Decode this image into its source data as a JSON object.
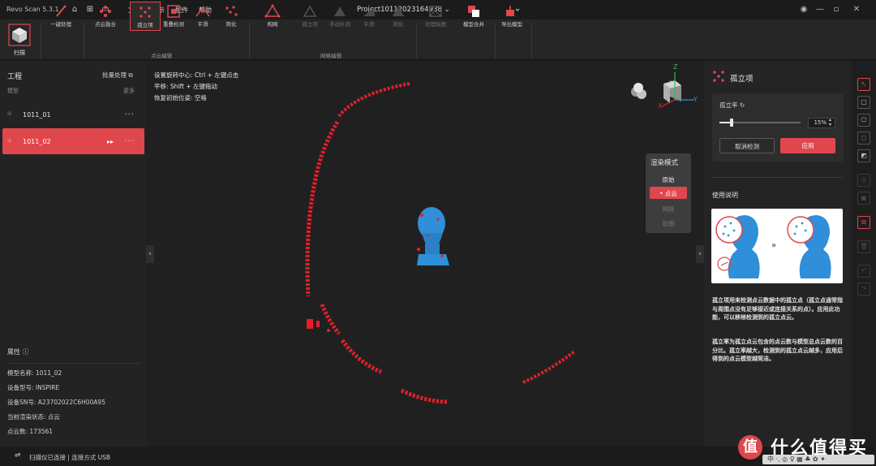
{
  "titlebar": {
    "app_name": "Revo Scan 5.3.1",
    "menus": [
      "文件",
      "显示",
      "配件",
      "帮助"
    ],
    "project": "Project10112023164938"
  },
  "toolbar": {
    "scan": "扫描",
    "one_click": "一键处理",
    "fusion": "点云融合",
    "isolate": "孤立项",
    "overlap": "重叠检测",
    "smooth": "平滑",
    "simplify": "简化",
    "mesh": "构网",
    "mesh_isolate": "孤立项",
    "fill_holes": "手动补洞",
    "mesh_smooth": "平滑",
    "mesh_simplify": "简化",
    "texture": "纹理贴图",
    "merge": "模型合并",
    "export": "导出模型",
    "group_pointcloud": "点云编辑",
    "group_mesh": "网格编辑"
  },
  "left_panel": {
    "title": "工程",
    "batch": "批量处理",
    "sub": "模型",
    "more": "更多",
    "models": [
      "1011_01",
      "1011_02"
    ],
    "attr_title": "属性",
    "attrs": [
      {
        "label": "模型名称:",
        "value": "1011_02"
      },
      {
        "label": "设备型号:",
        "value": "INSPIRE"
      },
      {
        "label": "设备SN号:",
        "value": "A23702022C6H00A95"
      },
      {
        "label": "当前渲染状态:",
        "value": "点云"
      },
      {
        "label": "点云数:",
        "value": "173561"
      }
    ]
  },
  "viewport": {
    "hints": [
      "设置旋转中心: Ctrl + 左键点击",
      "平移: Shift + 左键拖动",
      "恢复初始位姿: 空格"
    ],
    "render_mode": {
      "title": "渲染模式",
      "options": [
        "原始",
        "点云",
        "网格",
        "贴图"
      ],
      "selected": "点云"
    },
    "axes": {
      "x": "X",
      "y": "Y",
      "z": "Z"
    }
  },
  "right_panel": {
    "title": "孤立项",
    "rate_label": "孤立率",
    "rate_value": "15%",
    "rate_fraction": 0.15,
    "cancel": "取消检测",
    "apply": "应用",
    "usage_title": "使用说明",
    "desc1": "孤立项用来检测点云数据中的孤立点（孤立点通常指与周围点没有足够接近或连接关系的点）。应用此功能，可以移除检测到的孤立点云。",
    "desc2": "孤立率为孤立点云包含的点云数与模型总点云数的百分比。孤立率越大，检测到的孤立点云越多，应用后得到的点云模型越简洁。"
  },
  "status": {
    "text": "扫描仪已连接 | 连接方式 USB"
  },
  "watermark": {
    "logo": "值",
    "text": "什么值得买",
    "bar": "中 ·, ◎ ♀ ▦ ♣ ✿ ✦"
  },
  "colors": {
    "accent": "#e0474c",
    "model": "#2f8fd8",
    "points": "#e3202a"
  }
}
